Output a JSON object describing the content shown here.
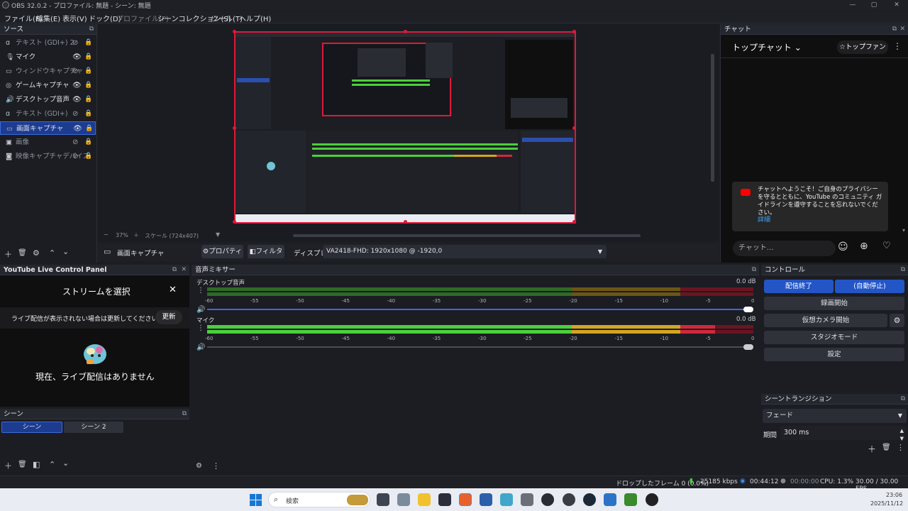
{
  "window": {
    "title": "OBS 32.0.2 - プロファイル: 無題 - シーン: 無題",
    "controls": [
      "—",
      "▢",
      "✕"
    ]
  },
  "menu": [
    "ファイル(F)",
    "編集(E)",
    "表示(V)",
    "ドック(D)",
    "プロファイル(P)",
    "シーンコレクション(S)",
    "ツール(T)",
    "ヘルプ(H)"
  ],
  "sources": {
    "title": "ソース",
    "items": [
      {
        "label": "テキスト (GDI+) 2",
        "icon": "text-icon",
        "visible": false
      },
      {
        "label": "マイク",
        "icon": "microphone-icon",
        "visible": true
      },
      {
        "label": "ウィンドウキャプチャ",
        "icon": "window-icon",
        "visible": false
      },
      {
        "label": "ゲームキャプチャ",
        "icon": "gamepad-icon",
        "visible": true
      },
      {
        "label": "デスクトップ音声",
        "icon": "speaker-icon",
        "visible": true
      },
      {
        "label": "テキスト (GDI+)",
        "icon": "text-icon",
        "visible": false
      },
      {
        "label": "画面キャプチャ",
        "icon": "monitor-icon",
        "visible": true,
        "selected": true
      },
      {
        "label": "画像",
        "icon": "image-icon",
        "visible": false
      },
      {
        "label": "映像キャプチャデバイス",
        "icon": "camera-icon",
        "visible": false
      }
    ]
  },
  "preview": {
    "zoom": "37%",
    "scale": "スケール (724x407)"
  },
  "propbar": {
    "source_name": "画面キャプチャ",
    "properties": "プロパティ",
    "filters": "フィルタ",
    "display_label": "ディスプレイ",
    "display_value": "VA2418-FHD: 1920x1080 @ -1920,0"
  },
  "chat": {
    "panel_title": "チャット",
    "top_chat": "トップチャット",
    "top_fans": "トップファン",
    "welcome": "チャットへようこそ！ご自身のプライバシーを守るとともに、YouTube のコミュニティ ガイドラインを遵守することを忘れないでください。",
    "details": "詳細",
    "input_placeholder": "チャット..."
  },
  "yt_panel": {
    "title": "YouTube Live Control Panel",
    "select_stream": "ストリームを選択",
    "refresh_hint": "ライブ配信が表示されない場合は更新してください",
    "refresh": "更新",
    "no_live": "現在、ライブ配信はありません"
  },
  "scenes": {
    "title": "シーン",
    "items": [
      "シーン",
      "シーン 2"
    ]
  },
  "mixer": {
    "title": "音声ミキサー",
    "ticks": [
      "-60",
      "-55",
      "-50",
      "-45",
      "-40",
      "-35",
      "-30",
      "-25",
      "-20",
      "-15",
      "-10",
      "-5",
      "0"
    ],
    "channels": [
      {
        "name": "デスクトップ音声",
        "db": "0.0 dB",
        "level": 0.0
      },
      {
        "name": "マイク",
        "db": "0.0 dB",
        "level": 0.93
      }
    ]
  },
  "controls": {
    "title": "コントロール",
    "stop_stream": "配信終了",
    "auto_stop": "(自動停止)",
    "start_recording": "録画開始",
    "virtual_camera": "仮想カメラ開始",
    "studio_mode": "スタジオモード",
    "settings": "設定"
  },
  "transitions": {
    "title": "シーントランジション",
    "type": "フェード",
    "duration_label": "期間",
    "duration": "300 ms"
  },
  "status": {
    "dropped": "ドロップしたフレーム 0 (0.0%)",
    "bitrate": "25185 kbps",
    "stream_time": "00:44:12",
    "rec_time": "00:00:00",
    "cpu": "CPU: 1.3%",
    "fps": "30.00 / 30.00 FPS"
  },
  "taskbar": {
    "search": "検索",
    "time": "23:06",
    "date": "2025/11/12"
  },
  "colors": {
    "accent": "#1d3b8f",
    "selection_border": "#e0183a",
    "meter_green": "#4ccf3c",
    "meter_yellow": "#d4a520",
    "meter_red": "#d2283c"
  }
}
